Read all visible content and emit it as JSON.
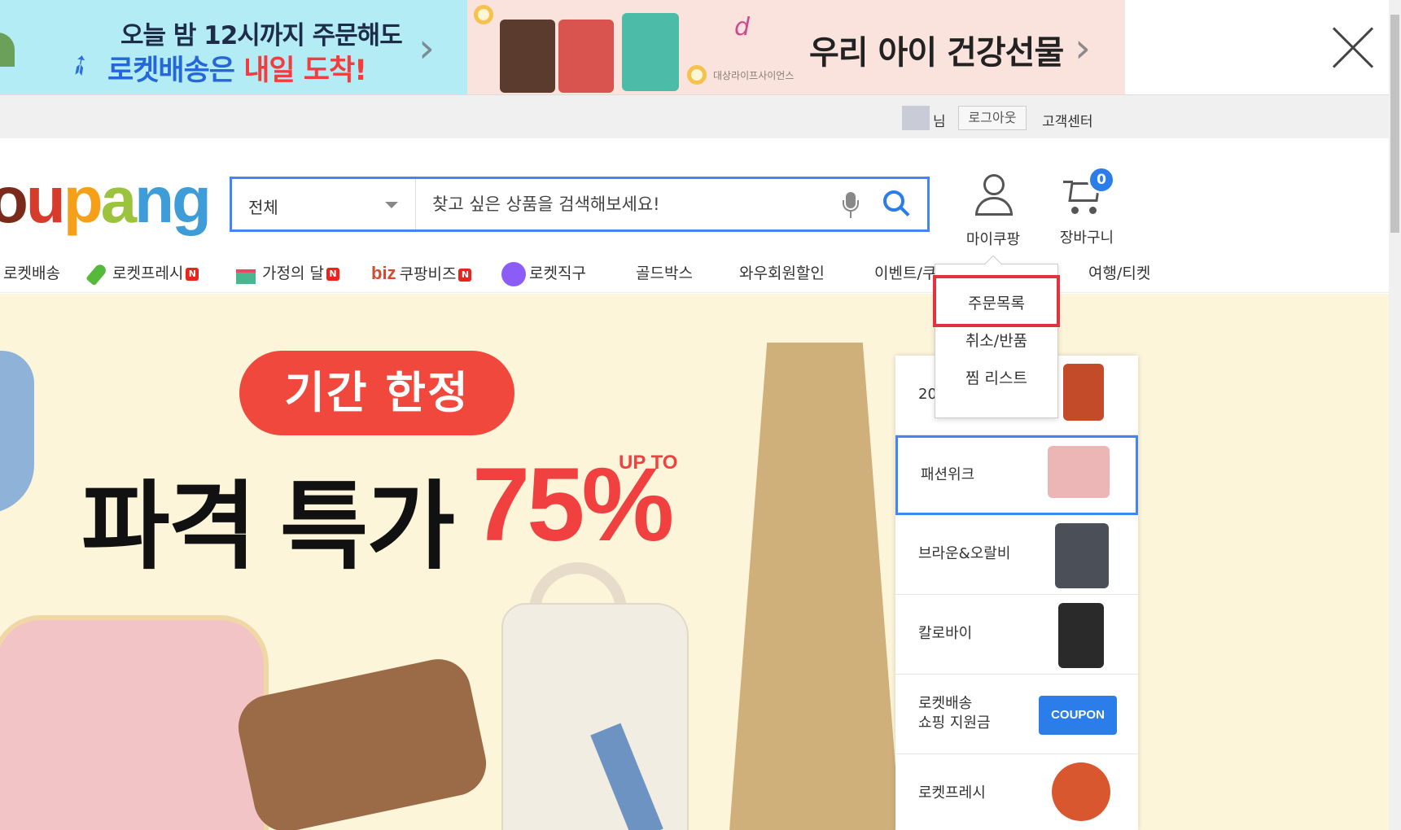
{
  "ads": {
    "left": {
      "line1": "오늘 밤 12시까지 주문해도",
      "line2_a": "로켓배송은 ",
      "line2_b": "내일 도착!"
    },
    "middle": {
      "brand": "대상라이프사이언스",
      "title": "우리 아이 건강선물"
    }
  },
  "topbar": {
    "nim": "님",
    "logout": "로그아웃",
    "customer_center": "고객센터"
  },
  "logo": {
    "p1": "o",
    "p2": "u",
    "p3": "p",
    "p4": "a",
    "p5": "ng"
  },
  "search": {
    "category": "전체",
    "placeholder": "찾고 싶은 상품을 검색해보세요!"
  },
  "header": {
    "mycoupang": "마이쿠팡",
    "cart": "장바구니",
    "cart_count": "0"
  },
  "nav": {
    "items": [
      {
        "label": "로켓배송"
      },
      {
        "label": "로켓프레시",
        "badge": "N"
      },
      {
        "label": "가정의 달",
        "badge": "N"
      },
      {
        "prefix": "biz",
        "label": "쿠팡비즈",
        "badge": "N"
      },
      {
        "label": "로켓직구"
      },
      {
        "label": "골드박스"
      },
      {
        "label": "와우회원할인"
      },
      {
        "label": "이벤트/쿠"
      },
      {
        "label": "여행/티켓"
      }
    ]
  },
  "dropdown": {
    "items": [
      "주문목록",
      "취소/반품",
      "찜 리스트"
    ]
  },
  "promo": {
    "pill": "기간 한정",
    "headline": "파격 특가",
    "percent": "75%",
    "upto": "UP TO"
  },
  "sidelist": {
    "items": [
      {
        "label": "20"
      },
      {
        "label": "패션위크"
      },
      {
        "label": "브라운&오랄비"
      },
      {
        "label": "칼로바이"
      },
      {
        "label": "로켓배송",
        "label2": "쇼핑 지원금",
        "button": "COUPON"
      },
      {
        "label": "로켓프레시"
      }
    ]
  },
  "colors": {
    "accent": "#4285f4",
    "highlight": "#e0333f",
    "badge": "#e8241c"
  }
}
